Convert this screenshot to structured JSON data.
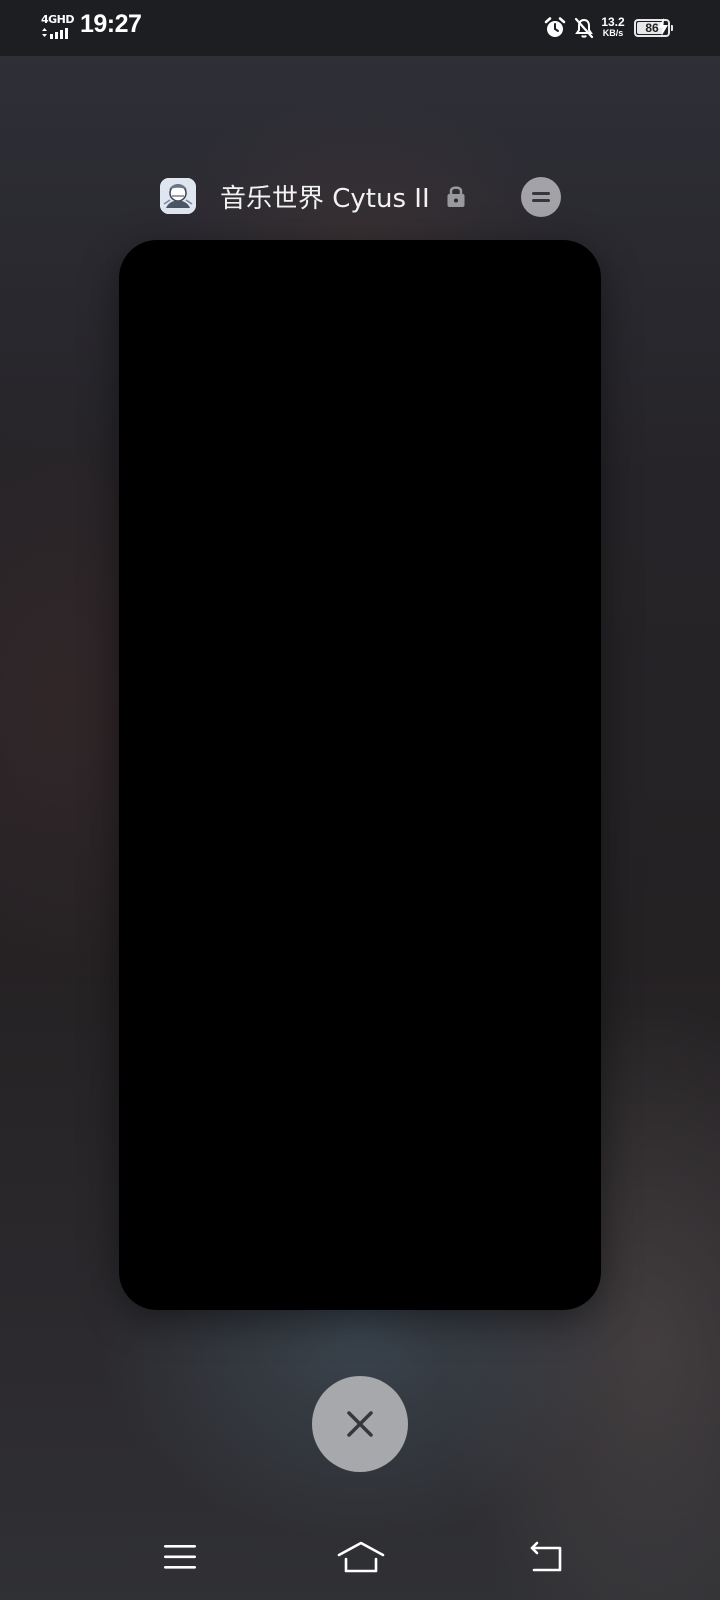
{
  "status_bar": {
    "network": "4GHD",
    "time": "19:27",
    "speed_value": "13.2",
    "speed_unit": "KB/s",
    "battery_level": "86",
    "icons": [
      "alarm-icon",
      "mute-bell-icon",
      "charging-bolt-icon"
    ]
  },
  "recent_app": {
    "title": "音乐世界 Cytus II",
    "icons": [
      "app-icon",
      "lock-icon",
      "menu-icon"
    ]
  },
  "controls": {
    "clear_icon": "close-icon"
  },
  "nav_bar": {
    "icons": [
      "menu-lines-icon",
      "home-icon",
      "back-icon"
    ]
  },
  "colors": {
    "card": "#000000",
    "button_gray": "#a7a8ab",
    "icon_dark": "#36373c"
  }
}
